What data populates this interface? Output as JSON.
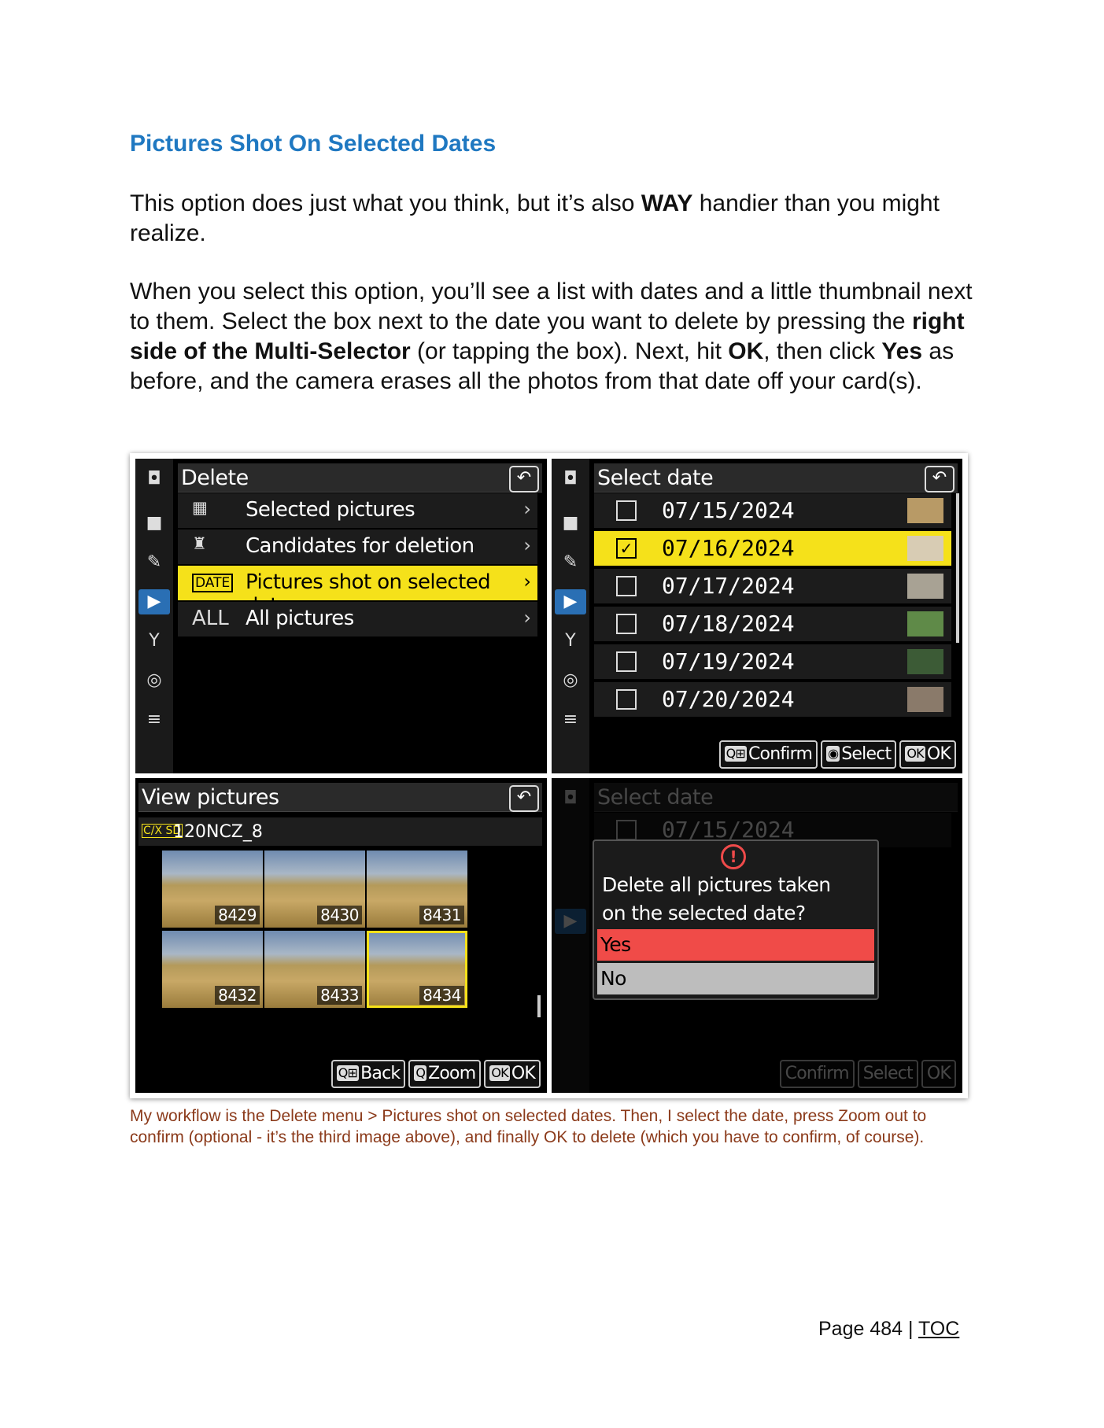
{
  "heading": "Pictures Shot On Selected Dates",
  "para1": {
    "t1": "This option does just what you think, but it’s also ",
    "b1": "WAY",
    "t2": " handier than you might realize."
  },
  "para2": {
    "t1": "When you select this option, you’ll see a list with dates and a little thumbnail next to them. Select the box next to the date you want to delete by pressing the ",
    "b1": "right side of the Multi-Selector",
    "t2": " (or tapping the box). Next, hit ",
    "b2": "OK",
    "t3": ", then click ",
    "b3": "Yes",
    "t4": " as before, and the camera erases all the photos from that date off your card(s)."
  },
  "screen1": {
    "title": "Delete",
    "items": [
      {
        "icon": "▦",
        "label": "Selected pictures"
      },
      {
        "icon": "♜",
        "label": "Candidates for deletion"
      },
      {
        "icon": "DATE",
        "label": "Pictures shot on selected dates"
      },
      {
        "icon": "ALL",
        "label": "All pictures"
      }
    ]
  },
  "screen2": {
    "title": "Select date",
    "dates": [
      "07/15/2024",
      "07/16/2024",
      "07/17/2024",
      "07/18/2024",
      "07/19/2024",
      "07/20/2024"
    ],
    "buttons": {
      "confirm": "Confirm",
      "select": "Select",
      "ok": "OK"
    },
    "button_keys": {
      "confirm": "Q⊞",
      "select": "◉",
      "ok": "OK"
    }
  },
  "screen3": {
    "title": "View pictures",
    "folder_tag": "C/X SD",
    "folder": "120NCZ_8",
    "thumbs": [
      "8429",
      "8430",
      "8431",
      "8432",
      "8433",
      "8434"
    ],
    "buttons": {
      "back": "Back",
      "zoom": "Zoom",
      "ok": "OK"
    },
    "button_keys": {
      "back": "Q⊞",
      "zoom": "Q",
      "ok": "OK"
    }
  },
  "screen4": {
    "title": "Select date",
    "date": "07/15/2024",
    "question": "Delete all pictures taken on the selected date?",
    "yes": "Yes",
    "no": "No",
    "buttons": {
      "confirm": "Confirm",
      "select": "Select",
      "ok": "OK"
    }
  },
  "caption": "My workflow is the Delete menu > Pictures shot on selected dates. Then, I select the date, press Zoom out to confirm (optional - it’s the third image above), and finally OK to delete (which you have to confirm, of course).",
  "footer": {
    "page": "Page 484 | ",
    "toc": "TOC"
  },
  "colors": {
    "heading": "#1f78c1",
    "caption": "#8b3a1a",
    "highlight": "#f5e11a",
    "yes": "#f04b48"
  }
}
